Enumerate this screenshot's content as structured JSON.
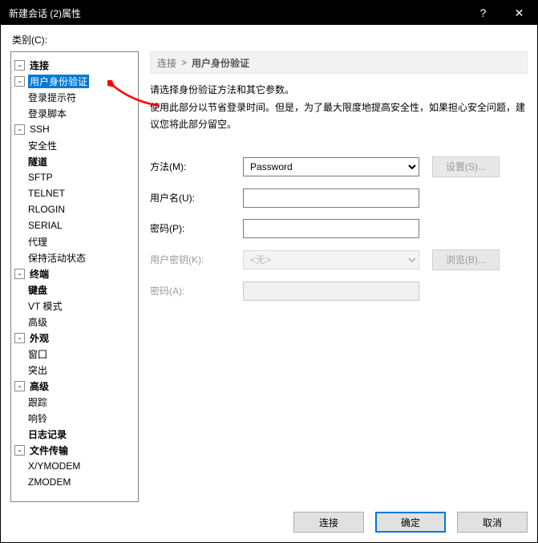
{
  "window": {
    "title": "新建会话 (2)属性",
    "help": "?",
    "close": "✕"
  },
  "category_label": "类别(C):",
  "tree": {
    "connection": "连接",
    "auth": "用户身份验证",
    "login_prompt": "登录提示符",
    "login_script": "登录脚本",
    "ssh": "SSH",
    "security": "安全性",
    "tunnel": "隧道",
    "sftp": "SFTP",
    "telnet": "TELNET",
    "rlogin": "RLOGIN",
    "serial": "SERIAL",
    "proxy": "代理",
    "keepalive": "保持活动状态",
    "terminal": "终端",
    "keyboard": "键盘",
    "vt": "VT 模式",
    "t_adv": "高级",
    "appearance": "外观",
    "window": "窗囗",
    "highlight": "突出",
    "advanced": "高级",
    "trace": "跟踪",
    "bell": "响铃",
    "logging": "日志记录",
    "transfer": "文件传输",
    "xym": "X/YMODEM",
    "zm": "ZMODEM"
  },
  "breadcrumb": {
    "root": "连接",
    "sep": ">",
    "current": "用户身份验证"
  },
  "desc": {
    "l1": "请选择身份验证方法和其它参数。",
    "l2": "使用此部分以节省登录时间。但是，为了最大限度地提高安全性，如果担心安全问题，建议您将此部分留空。"
  },
  "form": {
    "method_label": "方法(M):",
    "method_value": "Password",
    "settings_btn": "设置(S)...",
    "user_label": "用户名(U):",
    "user_value": "",
    "pass_label": "密码(P):",
    "pass_value": "",
    "key_label": "用户密钥(K):",
    "key_value": "<无>",
    "browse_btn": "浏览(B)...",
    "pass2_label": "密码(A):",
    "pass2_value": ""
  },
  "footer": {
    "connect": "连接",
    "ok": "确定",
    "cancel": "取消"
  }
}
